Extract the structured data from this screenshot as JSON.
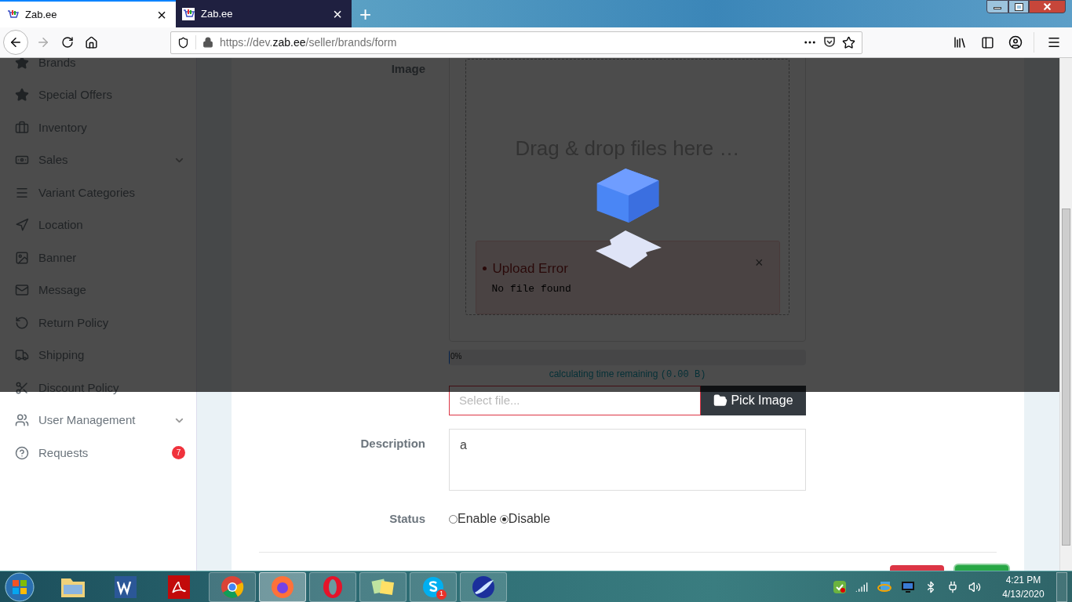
{
  "browser": {
    "tabs": [
      {
        "title": "Zab.ee",
        "close": "×",
        "selected": true
      },
      {
        "title": "Zab.ee",
        "close": "×",
        "selected": false
      }
    ],
    "new_tab": "+",
    "url": {
      "prefix": "https://dev.",
      "domain": "zab.ee",
      "path": "/seller/brands/form"
    }
  },
  "sidebar": {
    "items": [
      {
        "label": "Brands",
        "submenu": false
      },
      {
        "label": "Special Offers",
        "submenu": false
      },
      {
        "label": "Inventory",
        "submenu": false
      },
      {
        "label": "Sales",
        "submenu": true
      },
      {
        "label": "Variant Categories",
        "submenu": false
      },
      {
        "label": "Location",
        "submenu": false
      },
      {
        "label": "Banner",
        "submenu": false
      },
      {
        "label": "Message",
        "submenu": false
      },
      {
        "label": "Return Policy",
        "submenu": false
      },
      {
        "label": "Shipping",
        "submenu": false
      },
      {
        "label": "Discount Policy",
        "submenu": false
      },
      {
        "label": "User Management",
        "submenu": true
      },
      {
        "label": "Requests",
        "submenu": false,
        "badge": "7"
      }
    ]
  },
  "form": {
    "image": {
      "label": "Image",
      "dropzone_text": "Drag & drop files here …",
      "error": {
        "title": "Upload Error",
        "message": "No file found",
        "close": "×"
      },
      "progress": {
        "label": "0%",
        "level": 0
      },
      "remaining": {
        "text": "calculating time remaining",
        "size": "(0.00 B)"
      },
      "file_placeholder": "Select file...",
      "pick_button": "Pick Image"
    },
    "description": {
      "label": "Description",
      "value": "a"
    },
    "status": {
      "label": "Status",
      "options": [
        {
          "label": "Enable",
          "selected": false
        },
        {
          "label": "Disable",
          "selected": true
        }
      ]
    }
  },
  "taskbar": {
    "skype_badge": "1",
    "time": "4:21 PM",
    "date": "4/13/2020"
  }
}
